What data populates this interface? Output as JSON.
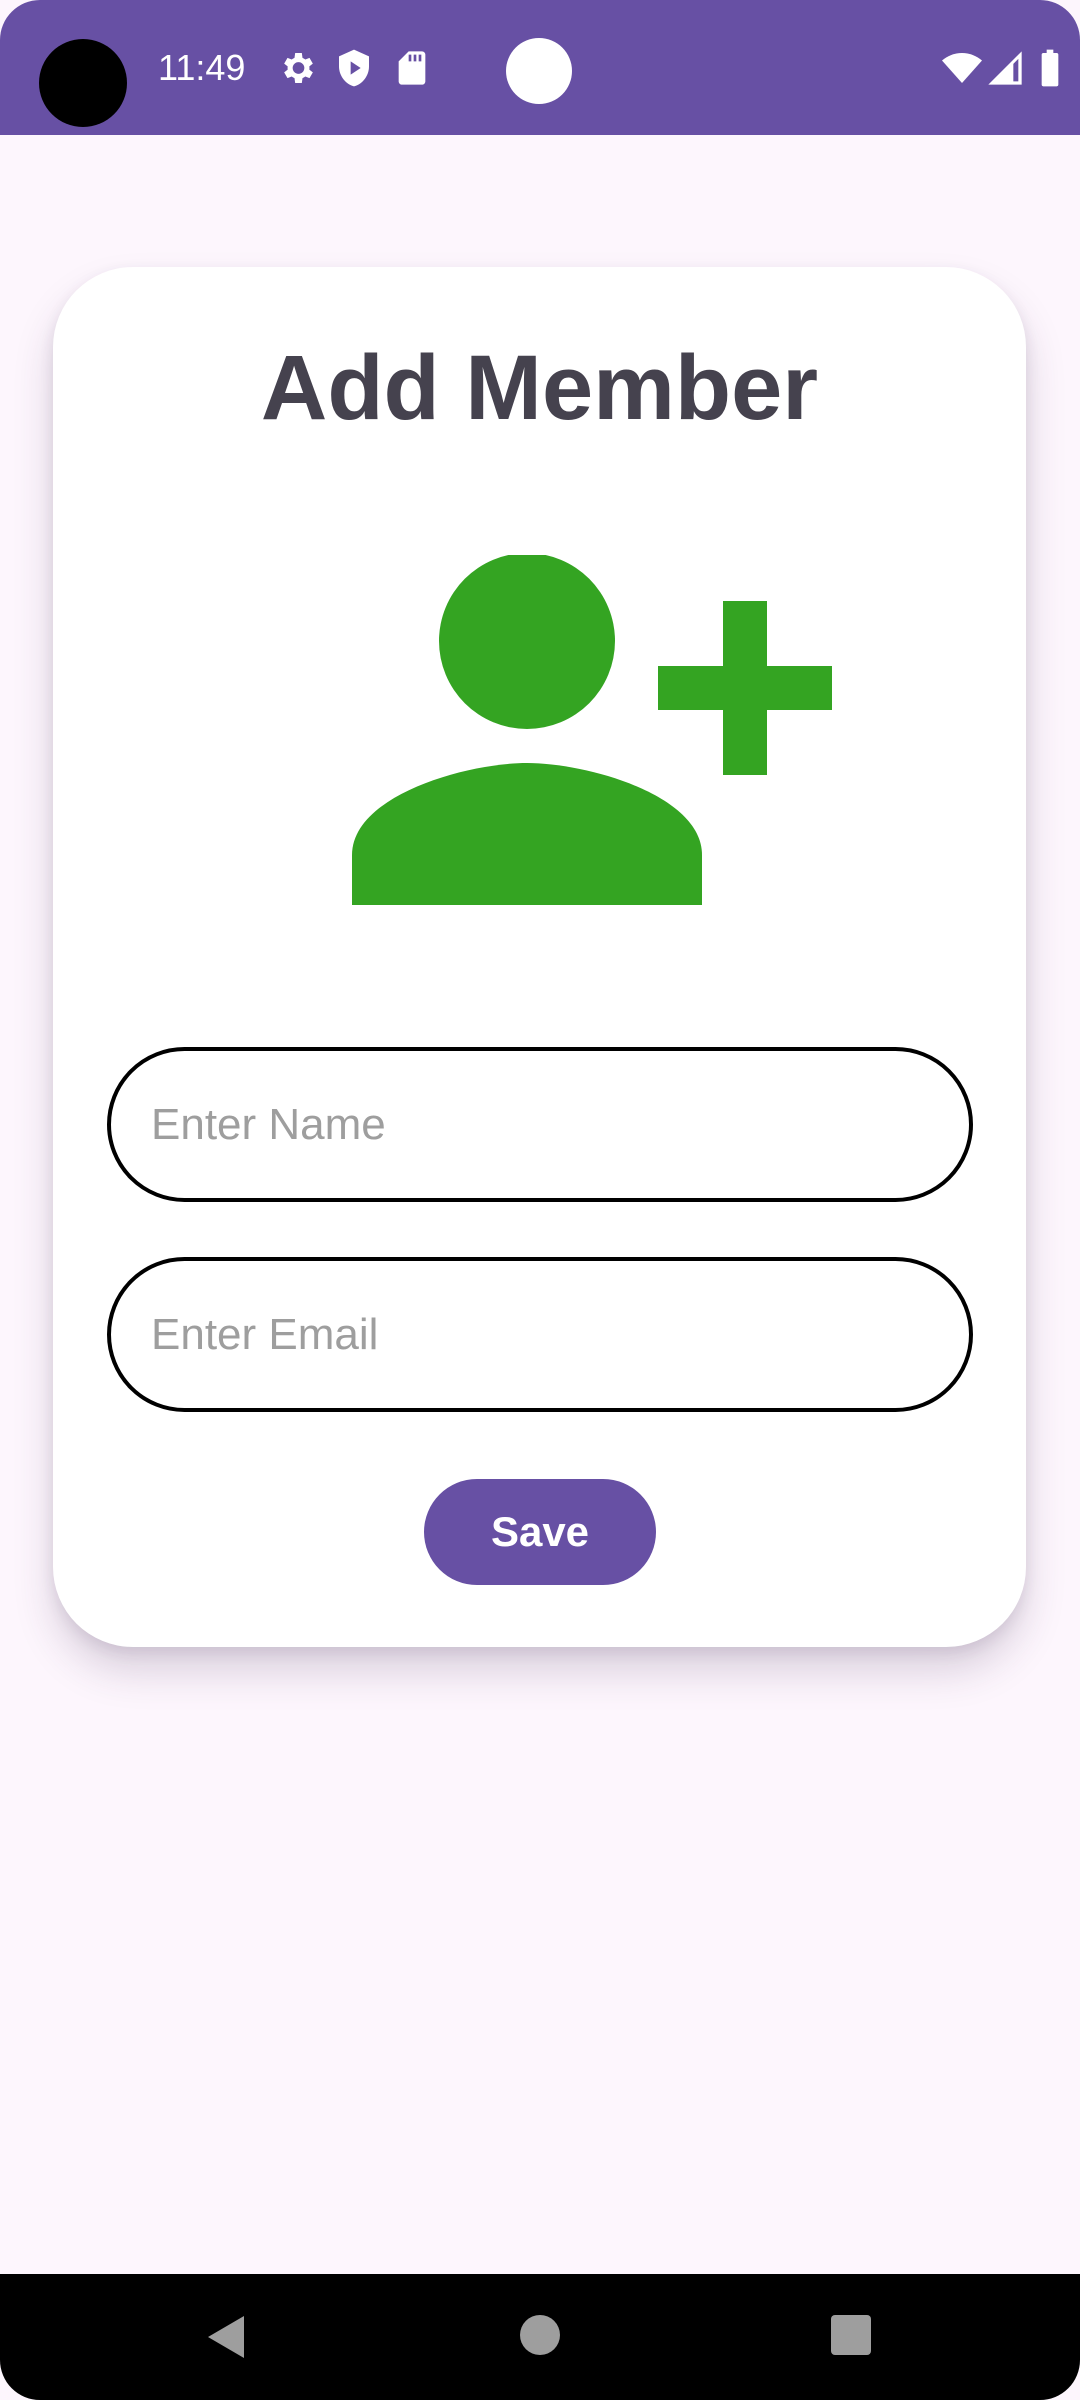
{
  "status_bar": {
    "time": "11:49",
    "icons": [
      "settings-icon",
      "shield-play-icon",
      "sd-card-icon",
      "wifi-icon",
      "signal-icon",
      "battery-icon"
    ]
  },
  "card": {
    "title": "Add Member",
    "icon": "add-person-icon"
  },
  "form": {
    "name_placeholder": "Enter Name",
    "name_value": "",
    "email_placeholder": "Enter Email",
    "email_value": "",
    "save_label": "Save"
  },
  "navigation": {
    "icons": [
      "back-icon",
      "home-icon",
      "recents-icon"
    ]
  },
  "colors": {
    "primary": "#6750a4",
    "icon_green": "#34a422",
    "title": "#45424e",
    "background": "#fdf6fd"
  }
}
